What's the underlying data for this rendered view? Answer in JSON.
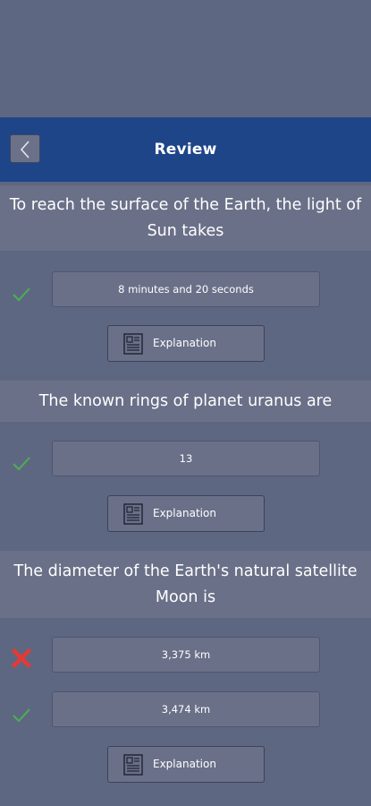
{
  "header": {
    "title": "Review",
    "back_icon": "chevron-left-icon"
  },
  "questions": [
    {
      "text": "To reach the surface of the Earth, the light of Sun takes",
      "answers": [
        {
          "text": "8 minutes and 20 seconds",
          "status": "correct"
        }
      ],
      "explanation_label": "Explanation"
    },
    {
      "text": "The known rings of planet uranus are",
      "answers": [
        {
          "text": "13",
          "status": "correct"
        }
      ],
      "explanation_label": "Explanation"
    },
    {
      "text": "The diameter of the Earth's natural satellite Moon is",
      "answers": [
        {
          "text": "3,375 km",
          "status": "wrong"
        },
        {
          "text": "3,474 km",
          "status": "correct"
        }
      ],
      "explanation_label": "Explanation"
    }
  ],
  "colors": {
    "background": "#5d6782",
    "header": "#1e4588",
    "panel": "#6a7088",
    "correct": "#4caf50",
    "wrong": "#e53935"
  }
}
